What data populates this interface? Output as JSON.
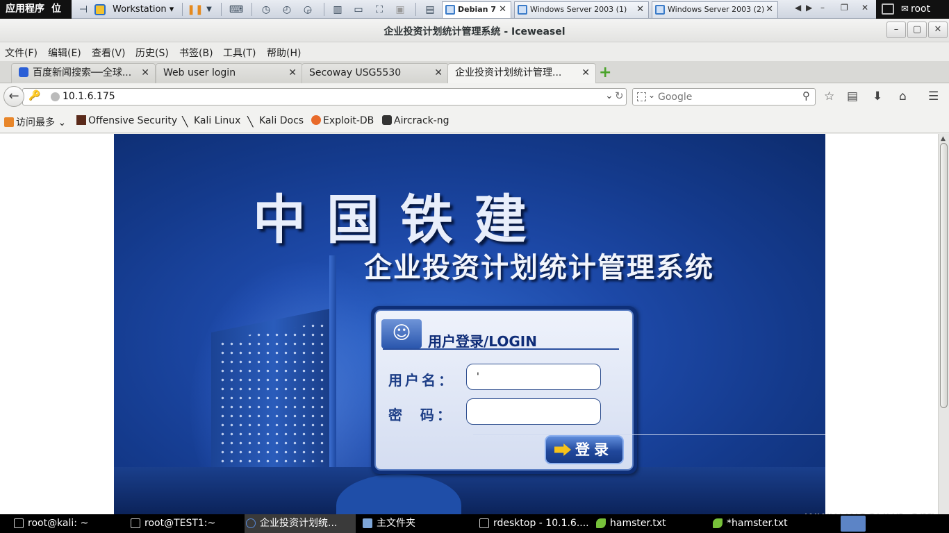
{
  "vmware": {
    "gnome_apps": "应用程序",
    "gnome_places": "位",
    "workstation_label": "Workstation",
    "tabs": [
      {
        "label": "Debian 7",
        "active": true
      },
      {
        "label": "Windows Server 2003 (1)",
        "active": false
      },
      {
        "label": "Windows Server 2003 (2)",
        "active": false
      }
    ],
    "user": "root"
  },
  "window": {
    "title": "企业投资计划统计管理系统 - Iceweasel"
  },
  "menu": [
    "文件(F)",
    "编辑(E)",
    "查看(V)",
    "历史(S)",
    "书签(B)",
    "工具(T)",
    "帮助(H)"
  ],
  "browser_tabs": [
    {
      "label": "百度新闻搜索──全球...",
      "active": false
    },
    {
      "label": "Web user login",
      "active": false
    },
    {
      "label": "Secoway USG5530",
      "active": false
    },
    {
      "label": "企业投资计划统计管理...",
      "active": true
    }
  ],
  "address": {
    "url": "10.1.6.175",
    "search_placeholder": "Google"
  },
  "bookmarks": [
    "访问最多",
    "Offensive Security",
    "Kali Linux",
    "Kali Docs",
    "Exploit-DB",
    "Aircrack-ng"
  ],
  "page": {
    "brand": "中国铁建",
    "system_name": "企业投资计划统计管理系统",
    "login_title": "用户登录/LOGIN",
    "username_label": "用户名：",
    "password_label": "密  码：",
    "username_value": "'",
    "password_value": "",
    "login_button": "登录",
    "watermark": "www.wooyun.org"
  },
  "taskbar": [
    {
      "label": "root@kali: ~",
      "active": false
    },
    {
      "label": "root@TEST1:~",
      "active": false
    },
    {
      "label": "企业投资计划统...",
      "active": true
    },
    {
      "label": "主文件夹",
      "active": false
    },
    {
      "label": "rdesktop - 10.1.6....",
      "active": false
    },
    {
      "label": "hamster.txt",
      "active": false
    },
    {
      "label": "*hamster.txt",
      "active": false
    }
  ]
}
